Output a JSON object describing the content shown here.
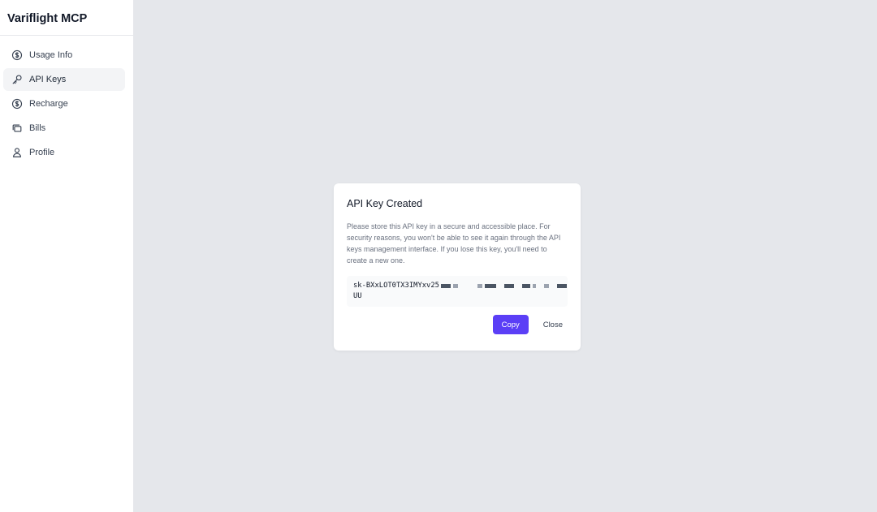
{
  "app": {
    "title": "Variflight MCP"
  },
  "sidebar": {
    "items": [
      {
        "label": "Usage Info",
        "icon": "dollar-circle-icon",
        "active": false
      },
      {
        "label": "API Keys",
        "icon": "key-icon",
        "active": true
      },
      {
        "label": "Recharge",
        "icon": "dollar-circle-icon",
        "active": false
      },
      {
        "label": "Bills",
        "icon": "cards-icon",
        "active": false
      },
      {
        "label": "Profile",
        "icon": "user-icon",
        "active": false
      }
    ]
  },
  "dialog": {
    "title": "API Key Created",
    "message": "Please store this API key in a secure and accessible place. For security reasons, you won't be able to see it again through the API keys management interface. If you lose this key, you'll need to create a new one.",
    "key_visible_prefix": "sk-BXxLOT0TX3IMYxv25",
    "key_visible_suffix": "UU",
    "copy_label": "Copy",
    "close_label": "Close"
  },
  "colors": {
    "accent": "#5b3ff6",
    "background": "#e5e7eb",
    "sidebar_active": "#f3f4f6"
  }
}
